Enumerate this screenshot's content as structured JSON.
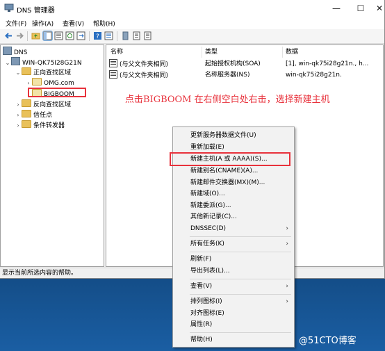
{
  "window": {
    "title": "DNS 管理器",
    "controls": [
      "—",
      "☐",
      "✕"
    ]
  },
  "menu": [
    "文件(F)",
    "操作(A)",
    "查看(V)",
    "帮助(H)"
  ],
  "toolbar": {
    "icons": [
      "back-icon",
      "forward-icon",
      "up-folder-icon",
      "show-tree-icon",
      "properties-icon",
      "refresh-icon",
      "export-icon",
      "help-icon",
      "details-icon",
      "server-icon",
      "record-icon",
      "record2-icon"
    ]
  },
  "tree": {
    "root": "DNS",
    "server": "WIN-QK75I28G21N",
    "forward_zones": "正向查找区域",
    "zone_omg": "OMG.com",
    "zone_bigboom": "BIGBOOM",
    "reverse_zones": "反向查找区域",
    "trust_points": "信任点",
    "conditional_forwarders": "条件转发器"
  },
  "list": {
    "columns": [
      "名称",
      "类型",
      "数据"
    ],
    "rows": [
      {
        "name": "(与父文件夹相同)",
        "type": "起始授权机构(SOA)",
        "data": "[1], win-qk75i28g21n., h..."
      },
      {
        "name": "(与父文件夹相同)",
        "type": "名称服务器(NS)",
        "data": "win-qk75i28g21n."
      }
    ]
  },
  "annotation": "点击BIGBOOM 在右侧空白处右击，选择新建主机",
  "status": "显示当前所选内容的帮助。",
  "context_menu": {
    "update_server_data": "更新服务器数据文件(U)",
    "reload": "重新加载(E)",
    "new_host": "新建主机(A 或 AAAA)(S)...",
    "new_alias": "新建别名(CNAME)(A)...",
    "new_mail_exchanger": "新建邮件交换器(MX)(M)...",
    "new_domain": "新建域(O)...",
    "new_delegation": "新建委派(G)...",
    "other_records": "其他新记录(C)...",
    "dnssec": "DNSSEC(D)",
    "all_tasks": "所有任务(K)",
    "refresh": "刷新(F)",
    "export_list": "导出列表(L)...",
    "view": "查看(V)",
    "arrange_icons": "排列图标(I)",
    "line_up_icons": "对齐图标(E)",
    "properties": "属性(R)",
    "help": "帮助(H)",
    "submenu_arrow": "›"
  },
  "watermark": "@51CTO博客",
  "colors": {
    "annotation_red": "#e8323c",
    "desktop_blue": "#0d3a68"
  }
}
